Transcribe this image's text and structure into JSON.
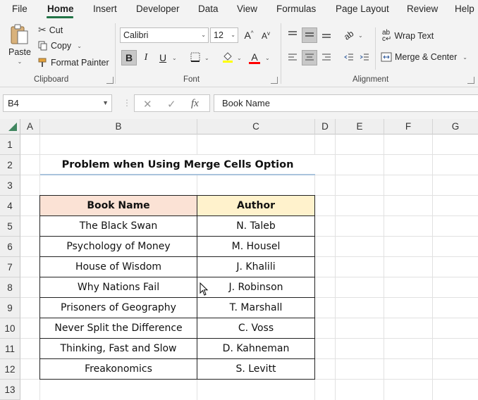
{
  "menu": {
    "items": [
      "File",
      "Home",
      "Insert",
      "Developer",
      "Data",
      "View",
      "Formulas",
      "Page Layout",
      "Review",
      "Help"
    ],
    "active": "Home"
  },
  "ribbon": {
    "clipboard": {
      "paste": "Paste",
      "cut": "Cut",
      "copy": "Copy",
      "format_painter": "Format Painter",
      "label": "Clipboard"
    },
    "font": {
      "name": "Calibri",
      "size": "12",
      "bold": "B",
      "italic": "I",
      "underline": "U",
      "label": "Font",
      "fill_color": "#ffff00",
      "font_color": "#ff0000"
    },
    "alignment": {
      "wrap_text": "Wrap Text",
      "merge_center": "Merge & Center",
      "label": "Alignment"
    }
  },
  "formula_bar": {
    "name_box": "B4",
    "fx": "fx",
    "content": "Book Name"
  },
  "sheet": {
    "columns": [
      "A",
      "B",
      "C",
      "D",
      "E",
      "F",
      "G"
    ],
    "rows": [
      "1",
      "2",
      "3",
      "4",
      "5",
      "6",
      "7",
      "8",
      "9",
      "10",
      "11",
      "12",
      "13"
    ],
    "title": "Problem when Using Merge Cells Option",
    "table": {
      "headers": [
        "Book Name",
        "Author"
      ],
      "rows": [
        [
          "The Black Swan",
          "N. Taleb"
        ],
        [
          "Psychology of Money",
          "M. Housel"
        ],
        [
          "House of Wisdom",
          "J. Khalili"
        ],
        [
          "Why Nations Fail",
          "J. Robinson"
        ],
        [
          "Prisoners of Geography",
          "T. Marshall"
        ],
        [
          "Never Split the Difference",
          "C. Voss"
        ],
        [
          "Thinking, Fast and Slow",
          "D. Kahneman"
        ],
        [
          "Freakonomics",
          "S. Levitt"
        ]
      ]
    }
  },
  "colors": {
    "accent": "#217346",
    "header_book": "#fbe2d5",
    "header_author": "#fff2cc",
    "title_underline": "#a9c3dc"
  }
}
